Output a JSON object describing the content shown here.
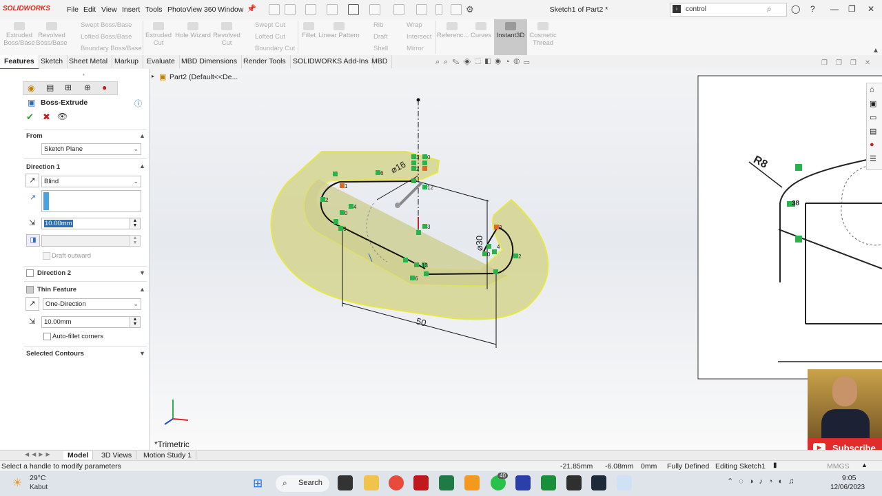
{
  "app": {
    "logo": "SOLIDWORKS",
    "window_title": "Sketch1 of Part2 *",
    "menu": [
      "File",
      "Edit",
      "View",
      "Insert",
      "Tools",
      "PhotoView 360",
      "Window"
    ],
    "search_value": "control"
  },
  "command_manager": {
    "extruded_boss": "Extruded\nBoss/Base",
    "revolved_boss": "Revolved\nBoss/Base",
    "swept_boss": "Swept Boss/Base",
    "lofted_boss": "Lofted Boss/Base",
    "boundary_boss": "Boundary Boss/Base",
    "extruded_cut": "Extruded\nCut",
    "hole_wizard": "Hole Wizard",
    "revolved_cut": "Revolved\nCut",
    "swept_cut": "Swept Cut",
    "lofted_cut": "Lofted Cut",
    "boundary_cut": "Boundary Cut",
    "fillet": "Fillet",
    "linear_pattern": "Linear Pattern",
    "rib": "Rib",
    "draft": "Draft",
    "shell": "Shell",
    "wrap": "Wrap",
    "intersect": "Intersect",
    "mirror": "Mirror",
    "reference": "Referenc...",
    "curves": "Curves",
    "instant3d": "Instant3D",
    "cosmetic_thread": "Cosmetic\nThread"
  },
  "tabs": [
    "Features",
    "Sketch",
    "Sheet Metal",
    "Markup",
    "Evaluate",
    "MBD Dimensions",
    "Render Tools",
    "SOLIDWORKS Add-Ins",
    "MBD"
  ],
  "tree": {
    "label": "Part2  (Default<<De..."
  },
  "property_manager": {
    "title": "Boss-Extrude",
    "from": {
      "header": "From",
      "value": "Sketch Plane"
    },
    "direction1": {
      "header": "Direction 1",
      "end_condition": "Blind",
      "depth": "10.00mm",
      "draft_label": "Draft outward"
    },
    "direction2": {
      "header": "Direction 2"
    },
    "thin_feature": {
      "header": "Thin Feature",
      "type": "One-Direction",
      "thickness": "10.00mm",
      "auto_fillet": "Auto-fillet corners"
    },
    "selected_contours": {
      "header": "Selected Contours"
    }
  },
  "viewport": {
    "view_label": "*Trimetric",
    "dims": {
      "d16": "⌀16",
      "d30": "⌀30",
      "l50": "50",
      "r8": "R8",
      "v38": "38"
    },
    "relation_labels": [
      "3",
      "2",
      "0",
      "1",
      "6",
      "1",
      "2",
      "4",
      "0",
      "3",
      "12",
      "3",
      "3",
      "4",
      "3",
      "0",
      "2",
      "13",
      "6",
      "3"
    ]
  },
  "bottom_tabs": [
    "Model",
    "3D Views",
    "Motion Study 1"
  ],
  "status": {
    "message": "Select a handle to modify parameters",
    "x": "-21.85mm",
    "y": "-6.08mm",
    "z": "0mm",
    "state": "Fully Defined",
    "editing": "Editing Sketch1",
    "units": "MMGS"
  },
  "taskbar": {
    "temp": "29°C",
    "weather": "Kabut",
    "search_label": "Search",
    "badge": "40",
    "time": "9:05",
    "date": "12/06/2023"
  },
  "overlay": {
    "subscribe": "Subscribe"
  },
  "colors": {
    "accent": "#2a6ebb",
    "highlight": "#e0e08a",
    "subscribe": "#e22c2c"
  }
}
